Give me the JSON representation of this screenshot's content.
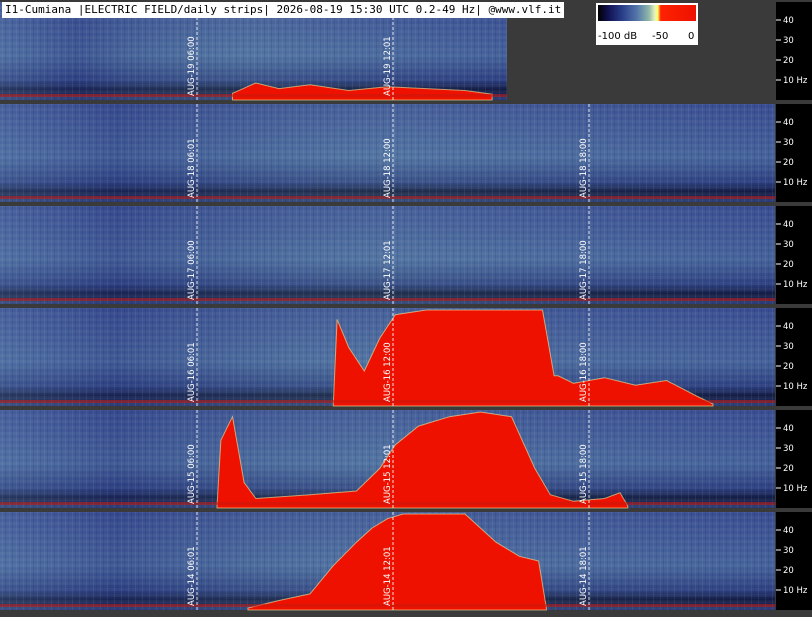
{
  "header": {
    "title": "I1-Cumiana |ELECTRIC FIELD/daily strips| 2026-08-19 15:30 UTC 0.2-49 Hz| @www.vlf.it"
  },
  "colorbar": {
    "label_min": "-100 dB",
    "label_mid": "-50",
    "label_max": "0"
  },
  "y_axis_ticks": [
    "40",
    "30",
    "20",
    "10 Hz"
  ],
  "colors": {
    "background": "#3a3a3a",
    "spectrogram_base": "#3a4f90",
    "storm": "#ee1100",
    "grid": "#ffffff"
  },
  "strips": [
    {
      "date_label": "AUG-19",
      "times": [
        "06:00",
        "12:01"
      ],
      "partial": true,
      "storm": [
        [
          0.3,
          0.05
        ],
        [
          0.33,
          0.16
        ],
        [
          0.36,
          0.1
        ],
        [
          0.4,
          0.14
        ],
        [
          0.45,
          0.08
        ],
        [
          0.5,
          0.12
        ],
        [
          0.55,
          0.1
        ],
        [
          0.6,
          0.08
        ],
        [
          0.635,
          0.04
        ]
      ]
    },
    {
      "date_label": "AUG-18",
      "times": [
        "06:01",
        "12:00",
        "18:00"
      ],
      "partial": false,
      "storm": []
    },
    {
      "date_label": "AUG-17",
      "times": [
        "06:00",
        "12:01",
        "18:00"
      ],
      "partial": false,
      "storm": []
    },
    {
      "date_label": "AUG-16",
      "times": [
        "06:01",
        "12:00",
        "18:00"
      ],
      "partial": false,
      "storm": [
        [
          0.43,
          0
        ],
        [
          0.435,
          0.9
        ],
        [
          0.45,
          0.6
        ],
        [
          0.47,
          0.35
        ],
        [
          0.49,
          0.7
        ],
        [
          0.51,
          0.95
        ],
        [
          0.55,
          1
        ],
        [
          0.6,
          1
        ],
        [
          0.66,
          1
        ],
        [
          0.7,
          1
        ],
        [
          0.715,
          0.3
        ],
        [
          0.72,
          0.3
        ],
        [
          0.74,
          0.22
        ],
        [
          0.78,
          0.28
        ],
        [
          0.82,
          0.2
        ],
        [
          0.86,
          0.25
        ],
        [
          0.9,
          0.08
        ],
        [
          0.92,
          0
        ]
      ]
    },
    {
      "date_label": "AUG-15",
      "times": [
        "06:00",
        "12:01",
        "18:00"
      ],
      "partial": false,
      "storm": [
        [
          0.28,
          0
        ],
        [
          0.285,
          0.7
        ],
        [
          0.3,
          0.95
        ],
        [
          0.315,
          0.25
        ],
        [
          0.33,
          0.08
        ],
        [
          0.4,
          0.12
        ],
        [
          0.46,
          0.16
        ],
        [
          0.49,
          0.4
        ],
        [
          0.51,
          0.65
        ],
        [
          0.54,
          0.85
        ],
        [
          0.58,
          0.95
        ],
        [
          0.62,
          1
        ],
        [
          0.66,
          0.95
        ],
        [
          0.69,
          0.4
        ],
        [
          0.71,
          0.12
        ],
        [
          0.74,
          0.05
        ],
        [
          0.78,
          0.08
        ],
        [
          0.8,
          0.14
        ],
        [
          0.81,
          0
        ]
      ]
    },
    {
      "date_label": "AUG-14",
      "times": [
        "06:01",
        "12:01",
        "18:01"
      ],
      "partial": false,
      "storm": [
        [
          0.32,
          0
        ],
        [
          0.36,
          0.08
        ],
        [
          0.4,
          0.15
        ],
        [
          0.43,
          0.45
        ],
        [
          0.46,
          0.7
        ],
        [
          0.48,
          0.85
        ],
        [
          0.5,
          0.95
        ],
        [
          0.52,
          1
        ],
        [
          0.56,
          1
        ],
        [
          0.6,
          1
        ],
        [
          0.64,
          0.7
        ],
        [
          0.67,
          0.55
        ],
        [
          0.695,
          0.5
        ],
        [
          0.705,
          0
        ]
      ]
    }
  ]
}
